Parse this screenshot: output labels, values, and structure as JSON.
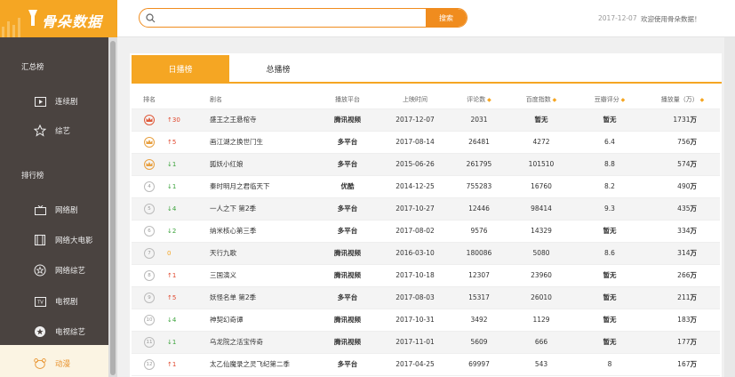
{
  "app": {
    "name": "骨朵数据"
  },
  "topbar": {
    "search_placeholder": "",
    "search_button": "搜索",
    "date": "2017-12-07",
    "welcome": "欢迎使用骨朵数据！"
  },
  "sidebar": {
    "section1": "汇总榜",
    "section2": "排行榜",
    "items": [
      {
        "label": "连续剧",
        "icon": "play-screen-icon"
      },
      {
        "label": "综艺",
        "icon": "star-icon"
      },
      {
        "label": "网络剧",
        "icon": "tv-icon"
      },
      {
        "label": "网络大电影",
        "icon": "film-icon"
      },
      {
        "label": "网络综艺",
        "icon": "star-circle-icon"
      },
      {
        "label": "电视剧",
        "icon": "tv-box-icon"
      },
      {
        "label": "电视综艺",
        "icon": "star-filled-icon"
      },
      {
        "label": "动漫",
        "icon": "bear-icon"
      }
    ]
  },
  "tabs": {
    "daily": "日播榜",
    "total": "总播榜"
  },
  "table": {
    "headers": {
      "rank": "排名",
      "name": "剧名",
      "platform": "播放平台",
      "date": "上映时间",
      "comments": "评论数",
      "baidu": "百度指数",
      "douban": "豆瓣评分",
      "plays": "播放量（万）"
    },
    "unit": "万",
    "rows": [
      {
        "rank": "1",
        "trend": "↑30",
        "dir": "up",
        "name": "盛王之王悬棺寺",
        "platform": "腾讯视频",
        "date": "2017-12-07",
        "comments": "2031",
        "baidu": "暂无",
        "douban": "暂无",
        "plays": "1731"
      },
      {
        "rank": "2",
        "trend": "↑5",
        "dir": "up",
        "name": "画江湖之换世门生",
        "platform": "多平台",
        "date": "2017-08-14",
        "comments": "26481",
        "baidu": "4272",
        "douban": "6.4",
        "plays": "756"
      },
      {
        "rank": "3",
        "trend": "↓1",
        "dir": "down",
        "name": "狐妖小红娘",
        "platform": "多平台",
        "date": "2015-06-26",
        "comments": "261795",
        "baidu": "101510",
        "douban": "8.8",
        "plays": "574"
      },
      {
        "rank": "4",
        "trend": "↓1",
        "dir": "down",
        "name": "秦时明月之君临天下",
        "platform": "优酷",
        "date": "2014-12-25",
        "comments": "755283",
        "baidu": "16760",
        "douban": "8.2",
        "plays": "490"
      },
      {
        "rank": "5",
        "trend": "↓4",
        "dir": "down",
        "name": "一人之下 第2季",
        "platform": "多平台",
        "date": "2017-10-27",
        "comments": "12446",
        "baidu": "98414",
        "douban": "9.3",
        "plays": "435"
      },
      {
        "rank": "6",
        "trend": "↓2",
        "dir": "down",
        "name": "纳米核心第三季",
        "platform": "多平台",
        "date": "2017-08-02",
        "comments": "9576",
        "baidu": "14329",
        "douban": "暂无",
        "plays": "334"
      },
      {
        "rank": "7",
        "trend": "0",
        "dir": "same",
        "name": "天行九歌",
        "platform": "腾讯视频",
        "date": "2016-03-10",
        "comments": "180086",
        "baidu": "5080",
        "douban": "8.6",
        "plays": "314"
      },
      {
        "rank": "8",
        "trend": "↑1",
        "dir": "up",
        "name": "三国演义",
        "platform": "腾讯视频",
        "date": "2017-10-18",
        "comments": "12307",
        "baidu": "23960",
        "douban": "暂无",
        "plays": "266"
      },
      {
        "rank": "9",
        "trend": "↑5",
        "dir": "up",
        "name": "妖怪名单 第2季",
        "platform": "多平台",
        "date": "2017-08-03",
        "comments": "15317",
        "baidu": "26010",
        "douban": "暂无",
        "plays": "211"
      },
      {
        "rank": "10",
        "trend": "↓4",
        "dir": "down",
        "name": "神契幻奇谭",
        "platform": "腾讯视频",
        "date": "2017-10-31",
        "comments": "3492",
        "baidu": "1129",
        "douban": "暂无",
        "plays": "183"
      },
      {
        "rank": "11",
        "trend": "↓1",
        "dir": "down",
        "name": "乌龙院之活宝传奇",
        "platform": "腾讯视频",
        "date": "2017-11-01",
        "comments": "5609",
        "baidu": "666",
        "douban": "暂无",
        "plays": "177"
      },
      {
        "rank": "12",
        "trend": "↑1",
        "dir": "up",
        "name": "太乙仙魔录之灵飞纪第二季",
        "platform": "多平台",
        "date": "2017-04-25",
        "comments": "69997",
        "baidu": "543",
        "douban": "8",
        "plays": "167"
      }
    ]
  }
}
